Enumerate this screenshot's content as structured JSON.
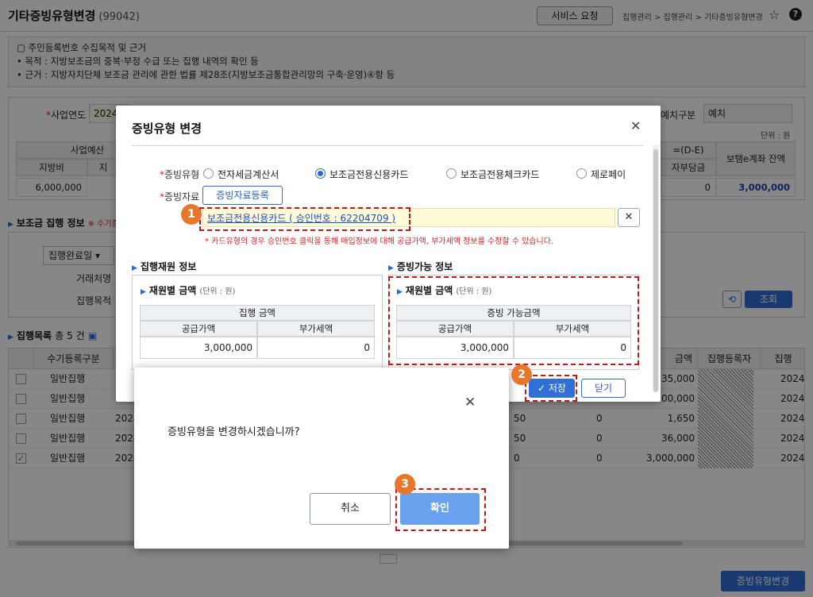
{
  "page": {
    "title": "기타증빙유형변경",
    "code": "(99042)",
    "service_button": "서비스 요청",
    "breadcrumb": "집행관리 > 집행관리 > 기타증빙유형변경",
    "notice_title": "주민등록번호 수집목적 및 근거",
    "notice_lines": [
      "• 목적 : 지방보조금의 중복·부정 수급 또는 집행 내역의 확인 등",
      "• 근거 : 지방자치단체 보조금 관리에 관한 법률 제28조(지방보조금통합관리망의 구축·운영)④항 등"
    ]
  },
  "conditions": {
    "year_label": "사업연도",
    "year_value": "2024",
    "deposit_label": "예치구분",
    "deposit_value": "예치",
    "unit": "단위 : 원",
    "budget_header": "사업예산",
    "local_header": "지방비",
    "local_value": "6,000,000",
    "partial_header": "지",
    "diff_header": "=(D-E)",
    "self_header": "자부담금",
    "self_value": "0",
    "balance_header": "보탬e계좌 잔액",
    "balance_value": "3,000,000"
  },
  "exec_info": {
    "title": "보조금 집행 정보",
    "sub": "※ 수기증",
    "status_select": "집행완료일",
    "vendor_label": "거래처명",
    "purpose_label": "집행목적",
    "search_button": "조회"
  },
  "list": {
    "title": "집행목록",
    "count": "총 5 건",
    "headers": {
      "type": "수기등록구분",
      "amount": "금액",
      "registrant": "집행등록자",
      "date": "집행"
    },
    "rows": [
      {
        "checked": "",
        "type": "일반집행",
        "date": "",
        "c1": "",
        "c2": "",
        "amount": "35,000",
        "reg": "2024"
      },
      {
        "checked": "",
        "type": "일반집행",
        "date": "",
        "c1": "",
        "c2": "",
        "amount": "00,000",
        "reg": "2024"
      },
      {
        "checked": "",
        "type": "일반집행",
        "date": "2024",
        "c1": "50",
        "c2": "0",
        "amount": "1,650",
        "reg": "2024"
      },
      {
        "checked": "",
        "type": "일반집행",
        "date": "2024",
        "c1": "50",
        "c2": "0",
        "amount": "36,000",
        "reg": "2024"
      },
      {
        "checked": "✓",
        "type": "일반집행",
        "date": "2024",
        "c1": "0",
        "c2": "0",
        "amount": "3,000,000",
        "reg": "2024"
      }
    ],
    "bottom_button": "증빙유형변경"
  },
  "modal": {
    "title": "증빙유형 변경",
    "proof_type_label": "증빙유형",
    "proof_type_options": [
      "전자세금계산서",
      "보조금전용신용카드",
      "보조금전용체크카드",
      "제로페이"
    ],
    "proof_data_label": "증빙자료",
    "proof_register_button": "증빙자료등록",
    "proof_link": "보조금전용신용카드 ( 승인번호 : 62204709 )",
    "warning": "* 카드유형의 경우 승인번호 클릭을 통해 매입정보에 대해 공급가액, 부가세액 정보를 수정할 수 있습니다.",
    "left_section": "집행재원 정보",
    "right_section": "증빙가능 정보",
    "left_panel_title": "재원별 금액",
    "right_panel_title": "재원별 금액",
    "panel_unit": "(단위 : 원)",
    "left_group_header": "집행 금액",
    "right_group_header": "증빙 가능금액",
    "supply_header": "공급가액",
    "vat_header": "부가세액",
    "left_supply": "3,000,000",
    "left_vat": "0",
    "right_supply": "3,000,000",
    "right_vat": "0",
    "save_button": "✓ 저장",
    "close_button": "닫기"
  },
  "confirm": {
    "message": "증빙유형을 변경하시겠습니까?",
    "cancel_button": "취소",
    "ok_button": "확인"
  },
  "annotations": [
    "1",
    "2",
    "3"
  ],
  "colors": {
    "primary": "#2f6fd6",
    "annotation_badge": "#e8772b",
    "annotation_border": "#c41818",
    "warning_text": "#dd2222"
  }
}
